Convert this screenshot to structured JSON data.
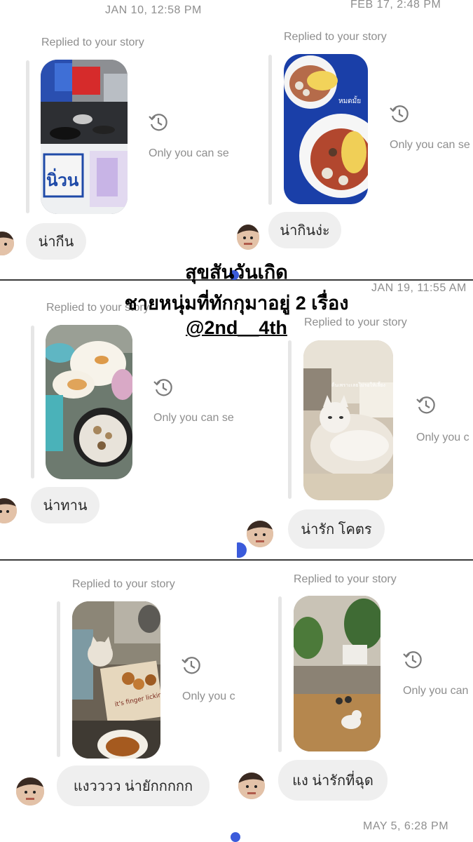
{
  "panels": {
    "p1": {
      "timestamp": "JAN 10, 12:58 PM",
      "replied": "Replied to your story",
      "only": "Only you can se",
      "message": "น่ากีน"
    },
    "p2": {
      "timestamp": "FEB 17, 2:48 PM",
      "replied": "Replied to your story",
      "only": "Only you can se",
      "message": "น่ากินง่ะ",
      "story_caption": "หมดมั้ย"
    },
    "p3": {
      "replied": "Replied to your story",
      "only": "Only you can se",
      "message": "น่าทาน"
    },
    "p4": {
      "timestamp": "JAN 19, 11:55 AM",
      "replied": "Replied to your story",
      "only": "Only you c",
      "message": "น่ารัก โคตร"
    },
    "p5": {
      "replied": "Replied to your story",
      "only": "Only you c",
      "message": "แงวววว น่ายักกกกก",
      "box_text": "it's finger lickin' good"
    },
    "p6": {
      "replied": "Replied to your story",
      "only": "Only you can",
      "message": "แง น่ารักที่ฉุด",
      "timestamp": "MAY 5, 6:28 PM"
    }
  },
  "overlay": {
    "line1": "สุขสันวันเกิด",
    "line2": "ชายหนุ่มที่ทักกุมาอยู่ 2 เรื่อง",
    "handle": "@2nd__4th"
  },
  "icons": {
    "history": "history-clock-icon"
  },
  "colors": {
    "bubble": "#efefef",
    "meta": "#8e8e8e",
    "accent": "#3b5bdb"
  }
}
